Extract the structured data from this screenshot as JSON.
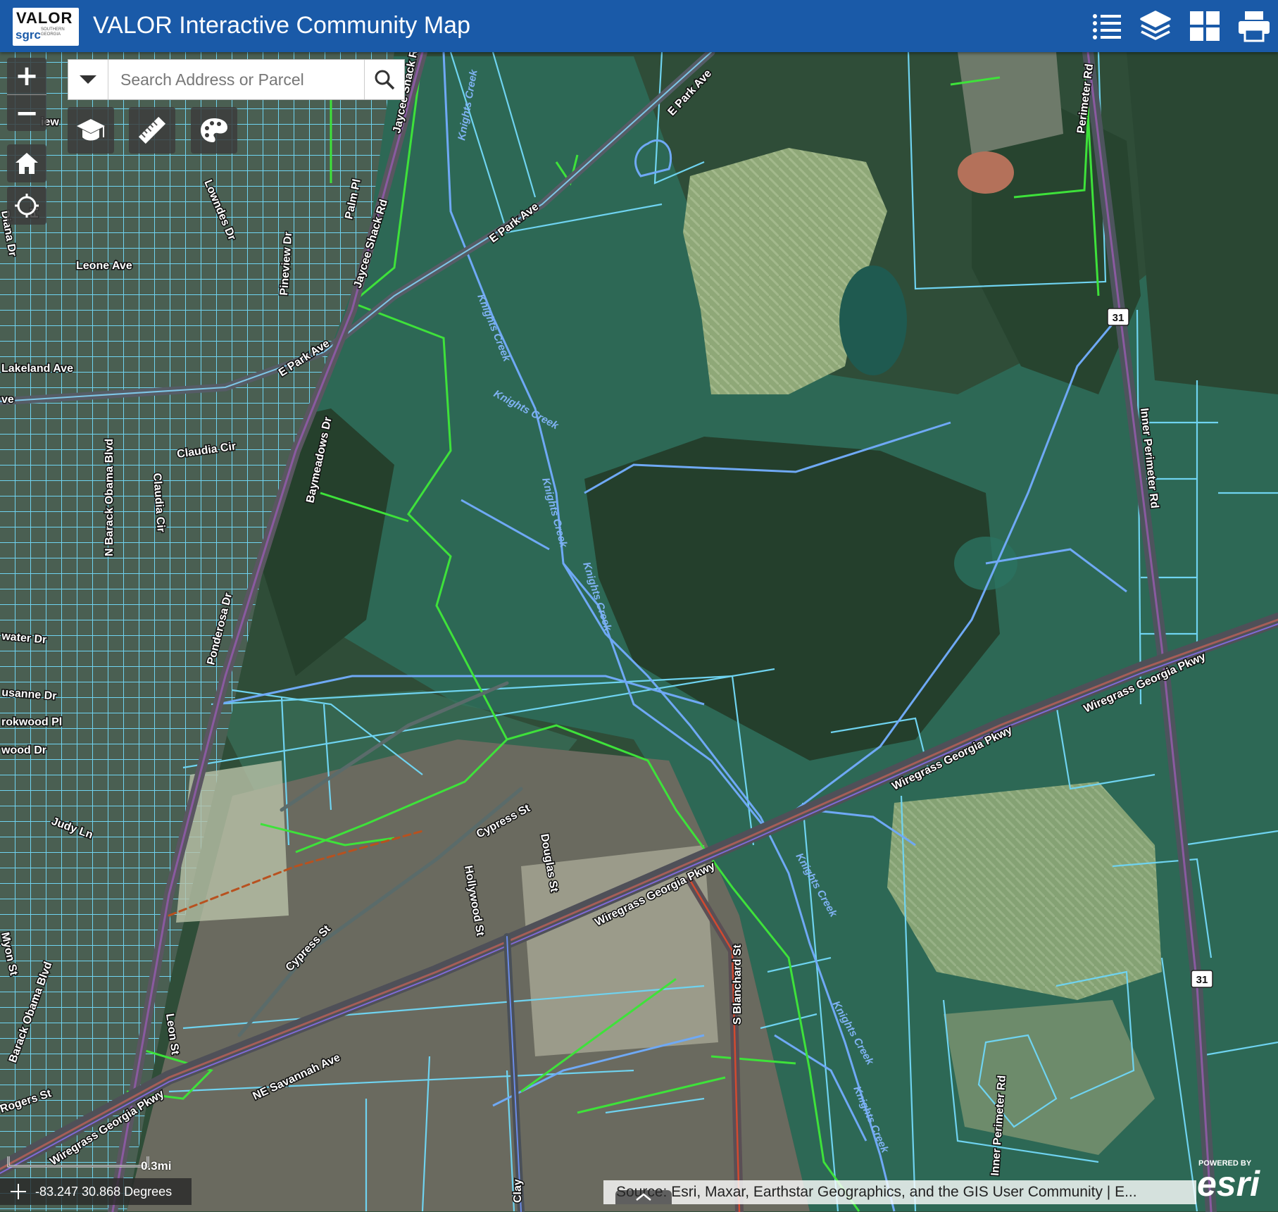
{
  "header": {
    "logo_text": "VALOR",
    "logo_sub": "sgrc",
    "logo_small": "SOUTHERN GEORGIA",
    "title": "VALOR Interactive Community Map",
    "buttons": [
      "legend-icon",
      "layers-icon",
      "basemap-gallery-icon",
      "print-icon"
    ]
  },
  "search": {
    "placeholder": "Search Address or Parcel"
  },
  "zoom": {
    "in_label": "+",
    "out_label": "−"
  },
  "tools": [
    "education-cap-icon",
    "ruler-icon",
    "palette-icon"
  ],
  "scale": {
    "label": "0.3mi"
  },
  "coordinates": {
    "text": "-83.247 30.868 Degrees"
  },
  "attribution": {
    "text": "Source: Esri, Maxar, Earthstar Geographics, and the GIS User Community | E..."
  },
  "esri": {
    "powered": "POWERED BY",
    "name": "esri"
  },
  "colors": {
    "header": "#1a5aa8",
    "parcel": "#6fd3f0",
    "creek": "#6fa9f5",
    "boundary": "#3ee23a",
    "highway": "#8a5aa0"
  },
  "map_labels": {
    "jaycee_shack": "Jaycee Shack Rd",
    "knights_creek": "Knights Creek",
    "e_park_ave": "E Park Ave",
    "perimeter_rd": "Perimeter Rd",
    "lowndes": "Lowndes Dr",
    "palm": "Palm Pl",
    "pineview": "Pineview Dr",
    "leone": "Leone Ave",
    "lakeland": "Lakeland Ave",
    "obama_blvd": "N Barack Obama Blvd",
    "baymeadows": "Baymeadows Dr",
    "claudia_cir": "Claudia Cir",
    "ponderosa": "Ponderosa Dr",
    "water_dr": "water Dr",
    "susanne": "usanne Dr",
    "brookwood": "rokwood Pl",
    "wood_dr": "wood Dr",
    "judy": "Judy Ln",
    "wiregrass": "Wiregrass Georgia Pkwy",
    "cypress": "Cypress St",
    "douglas": "Douglas St",
    "hollywood": "Hollywood St",
    "leon": "Leon St",
    "myon": "Myon St",
    "obama_s": "Barack Obama Blvd",
    "rogers": "Rogers St",
    "savannah": "NE Savannah Ave",
    "blanchard": "S Blanchard St",
    "clay": "Clay",
    "inner_perimeter": "Inner Perimeter Rd",
    "route31": "31",
    "fragment_view": "iew",
    "fragment_diana": "Diana Dr",
    "fragment_pl": "Pl",
    "fragment_ve": "ve"
  }
}
